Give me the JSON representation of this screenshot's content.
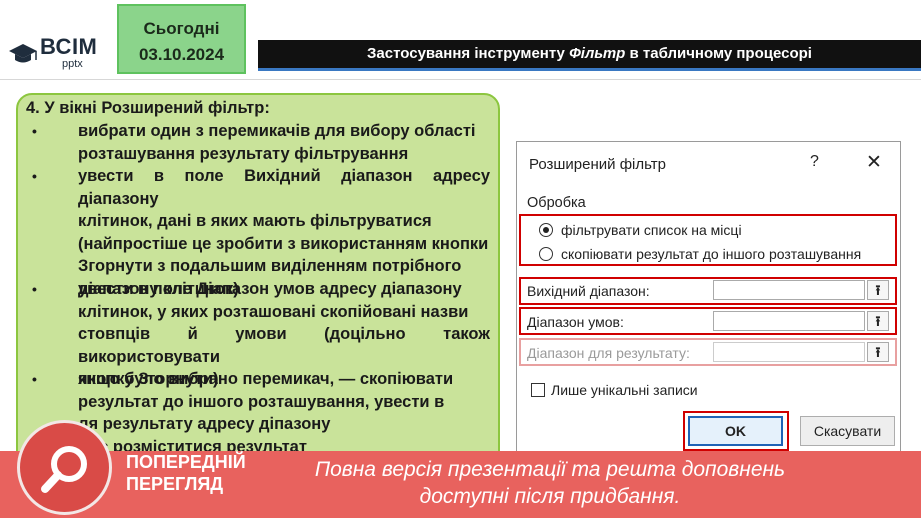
{
  "header": {
    "logo_main": "ВСІМ",
    "logo_sub": "pptx",
    "date_line1": "Сьогодні",
    "date_line2": "03.10.2024",
    "title_before": "Застосування інструменту ",
    "title_italic": "Фільтр",
    "title_after": " в табличному процесорі"
  },
  "content": {
    "heading": "4. У вікні Розширений фільтр:",
    "lines": [
      "вибрати один з перемикачів для вибору області",
      "розташування результату фільтрування",
      "увести в поле Вихідний діапазон адресу діапазону",
      "клітинок, дані в яких мають фільтруватися",
      "(найпростіше це зробити з використанням кнопки",
      "Згорнути з подальшим виділенням потрібного",
      "діапазону клітинок)",
      "увести в поле Діапазон умов адресу діапазону",
      "клітинок, у яких розташовані скопійовані назви",
      "стовпців й умови (доцільно також використовувати",
      "кнопку Згорнути)",
      "якщо було вибрано перемикач, — скопіювати",
      "результат до іншого розташування, увести в",
      "ля результату адресу діпазону",
      "має розміститися результат",
      "ОК"
    ]
  },
  "dialog": {
    "title": "Розширений фільтр",
    "help": "?",
    "close": "✕",
    "group_label": "Обробка",
    "radio_filter_in_place": "фільтрувати список на місці",
    "radio_copy_to": "скопіювати результат до іншого розташування",
    "field_list_range": "Вихідний діапазон:",
    "field_criteria_range": "Діапазон умов:",
    "field_copy_to": "Діапазон для результату:",
    "collapse_glyph": "⭱",
    "checkbox_unique": "Лише унікальні записи",
    "ok": "OK",
    "cancel": "Скасувати"
  },
  "banner": {
    "label_line1": "ПОПЕРЕДНІЙ",
    "label_line2": "ПЕРЕГЛЯД",
    "message_line1": "Повна версія презентації та решта доповнень",
    "message_line2": "доступні після придбання."
  },
  "colors": {
    "panel_bg": "#c9e39a",
    "panel_border": "#8cc63f",
    "date_bg": "#8bd48b",
    "title_bar": "#111111",
    "highlight_red": "#d00000",
    "banner_bg": "#e8625e"
  }
}
